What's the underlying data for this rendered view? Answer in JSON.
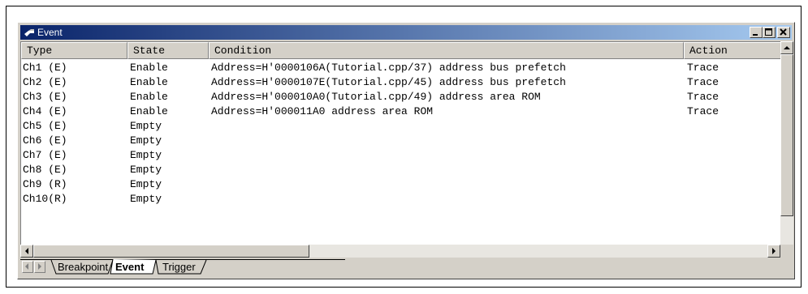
{
  "window": {
    "title": "Event"
  },
  "columns": [
    "Type",
    "State",
    "Condition",
    "Action"
  ],
  "rows": [
    {
      "type": "Ch1 (E)",
      "state": "Enable",
      "condition": "Address=H'0000106A(Tutorial.cpp/37) address bus prefetch",
      "action": "Trace"
    },
    {
      "type": "Ch2 (E)",
      "state": "Enable",
      "condition": "Address=H'0000107E(Tutorial.cpp/45) address bus prefetch",
      "action": "Trace"
    },
    {
      "type": "Ch3 (E)",
      "state": "Enable",
      "condition": "Address=H'000010A0(Tutorial.cpp/49) address area ROM",
      "action": "Trace"
    },
    {
      "type": "Ch4 (E)",
      "state": "Enable",
      "condition": "Address=H'000011A0 address area ROM",
      "action": "Trace"
    },
    {
      "type": "Ch5 (E)",
      "state": "Empty",
      "condition": "",
      "action": ""
    },
    {
      "type": "Ch6 (E)",
      "state": "Empty",
      "condition": "",
      "action": ""
    },
    {
      "type": "Ch7 (E)",
      "state": "Empty",
      "condition": "",
      "action": ""
    },
    {
      "type": "Ch8 (E)",
      "state": "Empty",
      "condition": "",
      "action": ""
    },
    {
      "type": "Ch9 (R)",
      "state": "Empty",
      "condition": "",
      "action": ""
    },
    {
      "type": "Ch10(R)",
      "state": "Empty",
      "condition": "",
      "action": ""
    }
  ],
  "tabs": [
    "Breakpoint",
    "Event",
    "Trigger"
  ],
  "active_tab": "Event",
  "icons": [
    "event-window-icon",
    "minimize-icon",
    "maximize-icon",
    "close-icon",
    "scroll-up-arrow-icon",
    "scroll-down-arrow-icon",
    "scroll-left-arrow-icon",
    "scroll-right-arrow-icon"
  ],
  "colors": {
    "titlebar_start": "#0a246a",
    "titlebar_end": "#a6caf0",
    "face": "#d4d0c8"
  }
}
